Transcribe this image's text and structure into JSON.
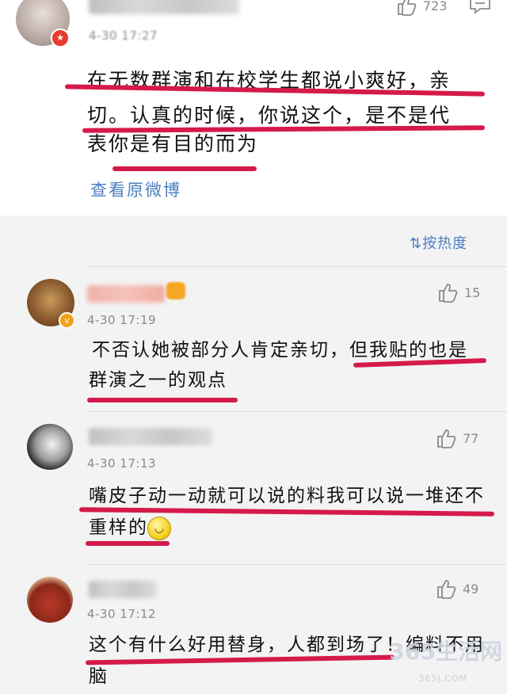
{
  "post": {
    "like_count": "723",
    "time": "4-30 17:27",
    "text_lines": [
      "在无数群演和在校学生都说小爽好，亲",
      "切。认真的时候，你说这个，是不是代",
      "表你是有目的而为"
    ],
    "view_original": "查看原微博"
  },
  "sort_label": "按热度",
  "comments": [
    {
      "time": "4-30 17:19",
      "likes": "15",
      "text_lines": [
        "不否认她被部分人肯定亲切，但我贴的也是",
        "群演之一的观点"
      ]
    },
    {
      "time": "4-30 17:13",
      "likes": "77",
      "text_lines": [
        "嘴皮子动一动就可以说的料我可以说一堆还不",
        "重样的"
      ]
    },
    {
      "time": "4-30 17:12",
      "likes": "49",
      "text_lines": [
        "这个有什么好用替身，人都到场了！编料不用",
        "脑"
      ]
    }
  ],
  "watermark": {
    "brand": "365生活网",
    "url": "365J.COM"
  },
  "colors": {
    "highlight": "#d51a4a",
    "link": "#4c7fbf"
  }
}
